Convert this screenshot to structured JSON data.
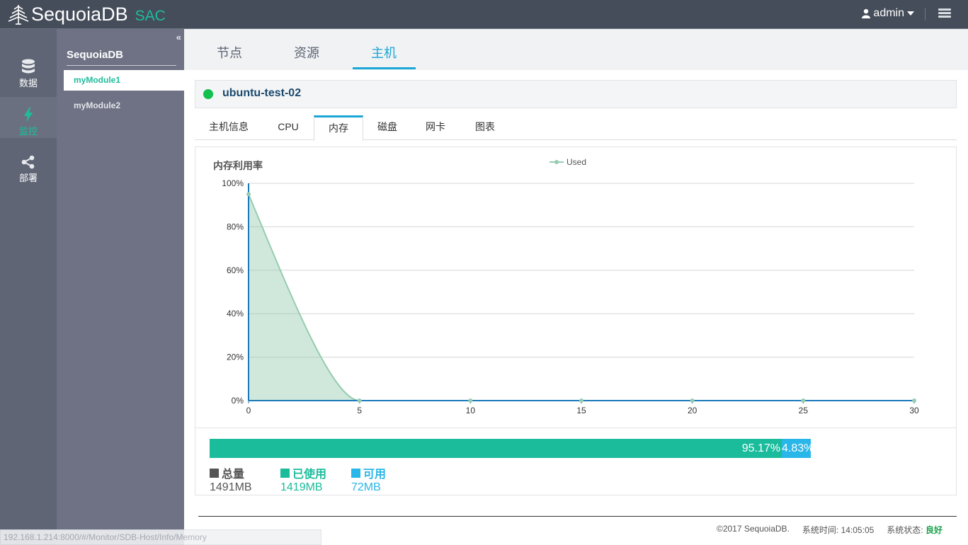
{
  "header": {
    "app_name": "SequoiaDB",
    "app_suffix": "SAC",
    "user": "admin"
  },
  "rail": {
    "items": [
      {
        "label": "数据",
        "icon": "database-icon"
      },
      {
        "label": "监控",
        "icon": "lightning-icon",
        "active": true
      },
      {
        "label": "部署",
        "icon": "share-icon"
      }
    ]
  },
  "sidebar": {
    "title": "SequoiaDB",
    "modules": [
      {
        "label": "myModule1",
        "active": true
      },
      {
        "label": "myModule2"
      }
    ]
  },
  "main": {
    "tabs": [
      {
        "label": "节点"
      },
      {
        "label": "资源"
      },
      {
        "label": "主机",
        "active": true
      }
    ],
    "host": {
      "name": "ubuntu-test-02",
      "status_color": "#11c04e"
    },
    "subtabs": [
      {
        "label": "主机信息"
      },
      {
        "label": "CPU"
      },
      {
        "label": "内存",
        "active": true
      },
      {
        "label": "磁盘"
      },
      {
        "label": "网卡"
      },
      {
        "label": "图表"
      }
    ]
  },
  "chart_data": {
    "type": "area",
    "title": "内存利用率",
    "series": [
      {
        "name": "Used",
        "color": "#96ccb0",
        "x": [
          0,
          5,
          10,
          15,
          20,
          25,
          30
        ],
        "values": [
          95,
          0,
          0,
          0,
          0,
          0,
          0
        ]
      }
    ],
    "xlim": [
      0,
      30
    ],
    "ylim": [
      0,
      100
    ],
    "x_ticks": [
      "0",
      "5",
      "10",
      "15",
      "20",
      "25",
      "30"
    ],
    "y_ticks": [
      "0%",
      "20%",
      "40%",
      "60%",
      "80%",
      "100%"
    ],
    "grid": true,
    "legend": "top-center"
  },
  "memory": {
    "used_pct": 95.17,
    "free_pct": 4.83,
    "used_label": "95.17%",
    "free_label": "4.83%",
    "total_label": "总量",
    "total_value": "1491MB",
    "used_title": "已使用",
    "used_value": "1419MB",
    "free_title": "可用",
    "free_value": "72MB",
    "colors": {
      "total": "#555555",
      "used": "#1abc9c",
      "free": "#29b6e8"
    }
  },
  "footer": {
    "copyright": "©2017 SequoiaDB.",
    "time_label": "系统时间: 14:05:05",
    "state_label": "系统状态:",
    "state_value": "良好"
  },
  "statusbar": {
    "url": "192.168.1.214:8000/#/Monitor/SDB-Host/Info/Memory"
  }
}
